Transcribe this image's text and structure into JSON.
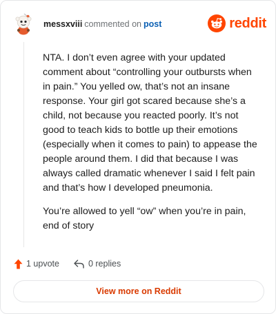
{
  "comment": {
    "author": "messxviii",
    "action_text": "commented on",
    "post_link_label": "post",
    "paragraphs": [
      "NTA. I don’t even agree with your updated comment about “controlling your outbursts when in pain.” You yelled ow, that’s not an insane response. Your girl got scared because she’s a child, not because you reacted poorly. It’s not good to teach kids to bottle up their emotions (especially when it comes to pain) to appease the people around them. I did that because I was always called dramatic whenever I said I felt pain and that’s how I developed pneumonia.",
      "You’re allowed to yell “ow” when you’re in pain, end of story"
    ],
    "upvote_label": "1 upvote",
    "replies_label": "0 replies"
  },
  "brand": {
    "wordmark": "reddit",
    "icon": "reddit-snoo-icon",
    "accent_color": "#ff4500"
  },
  "footer": {
    "view_more_label": "View more on Reddit"
  },
  "icons": {
    "avatar": "snoo-avatar-icon",
    "upvote": "upvote-arrow-icon",
    "reply": "reply-arrow-icon"
  }
}
